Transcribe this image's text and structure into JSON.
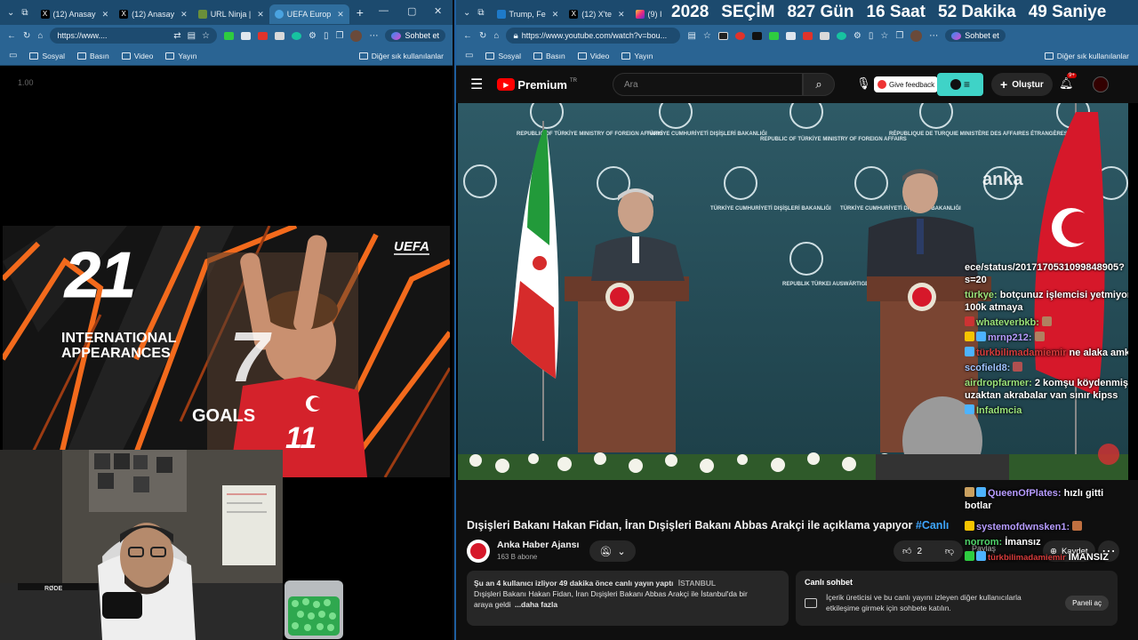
{
  "left_browser": {
    "tabs": [
      {
        "label": "(12) Anasay",
        "active": false
      },
      {
        "label": "(12) Anasay",
        "active": false
      },
      {
        "label": "URL Ninja |",
        "active": false
      },
      {
        "label": "UEFA Europ",
        "active": true
      }
    ],
    "new_tab_glyph": "+",
    "address": "https://www....",
    "chat_button": "Sohbet et",
    "bookmarks": [
      "Sosyal",
      "Basın",
      "Video",
      "Yayın"
    ],
    "other_bookmarks": "Diğer sık kullanılanlar",
    "zoom": "1.00",
    "uefa_logo": "UEFA",
    "uefa_number": "21",
    "uefa_line1": "INTERNATIONAL",
    "uefa_line2": "APPEARANCES",
    "uefa_number2": "7",
    "uefa_goals": "GOALS",
    "shirt_number": "11"
  },
  "right_browser": {
    "tabs": [
      {
        "label": "Trump, Fe",
        "active": false
      },
      {
        "label": "(12) X'te",
        "active": false
      },
      {
        "label": "(9) I",
        "active": false
      }
    ],
    "countdown": {
      "year": "2028",
      "word": "SEÇİM",
      "days": "827 Gün",
      "hours": "16 Saat",
      "minutes": "52 Dakika",
      "seconds": "49 Saniye"
    },
    "address": "https://www.youtube.com/watch?v=bou...",
    "chat_button": "Sohbet et",
    "bookmarks": [
      "Sosyal",
      "Basın",
      "Video",
      "Yayın"
    ],
    "other_bookmarks": "Diğer sık kullanılanlar"
  },
  "youtube": {
    "logo": "Premium",
    "logo_sup": "TR",
    "search_placeholder": "Ara",
    "feedback": "Give feedback",
    "create": "Oluştur",
    "notif_count": "9+",
    "watermark": "anka",
    "video_title": "Dışişleri Bakanı Hakan Fidan, İran Dışişleri Bakanı Abbas Arakçi ile açıklama yapıyor",
    "video_tag": "#Canlı",
    "channel_name": "Anka Haber Ajansı",
    "subscribers": "163 B abone",
    "likes": "2",
    "save_label": "Kaydet",
    "share_label": "Paylaş",
    "watching": "Şu an 4 kullanıcı izliyor  49 dakika önce canlı yayın yaptı",
    "location": "İSTANBUL",
    "desc_line1": "Dışişleri Bakanı Hakan Fidan, İran Dışişleri Bakanı Abbas Arakçi ile İstanbul'da bir",
    "desc_line2": "araya geldi",
    "more": "...daha fazla",
    "live_chat_title": "Canlı sohbet",
    "live_chat_text": "İçerik üreticisi ve bu canlı yayını izleyen diğer kullanıcılarla etkileşime girmek için sohbete katılın.",
    "open_panel": "Paneli aç",
    "flag_label_1": "REPUBLIC OF TÜRKİYE MINISTRY OF FOREIGN AFFAIRS",
    "flag_label_2": "TÜRKİYE CUMHURİYETİ DIŞİŞLERİ BAKANLIĞI",
    "flag_label_3": "RÉPUBLIQUE DE TURQUIE MINISTÈRE DES AFFAIRES ÉTRANGÈRES",
    "flag_label_4": "REPUBLIK TÜRKEI AUSWÄRTIGES AMT"
  },
  "overlay_chat": [
    {
      "name": "",
      "text": "ece/status/2017170531099848905?s=20"
    },
    {
      "name": "türkye:",
      "text": "botçunuz işlemcisi yetmiyor 100k atmaya"
    },
    {
      "name": "whateverbkb:",
      "text": ""
    },
    {
      "name": "mrnp212:",
      "text": ""
    },
    {
      "name": "türkbilimadamiemir",
      "text": "ne alaka amk"
    },
    {
      "name": "scofield8:",
      "text": ""
    },
    {
      "name": "airdropfarmer:",
      "text": "2 komşu köydenmiş uzaktan akrabalar van sınır kipss"
    },
    {
      "name": "Infadmcia",
      "text": ""
    },
    {
      "name": "QueenOfPlates:",
      "text": "hızlı gitti botlar"
    },
    {
      "name": "systemofdwnsken1:",
      "text": ""
    },
    {
      "name": "norrom:",
      "text": "İmansız"
    },
    {
      "name": "türkbilimadamiemir",
      "text": "İMANSIZ"
    }
  ]
}
